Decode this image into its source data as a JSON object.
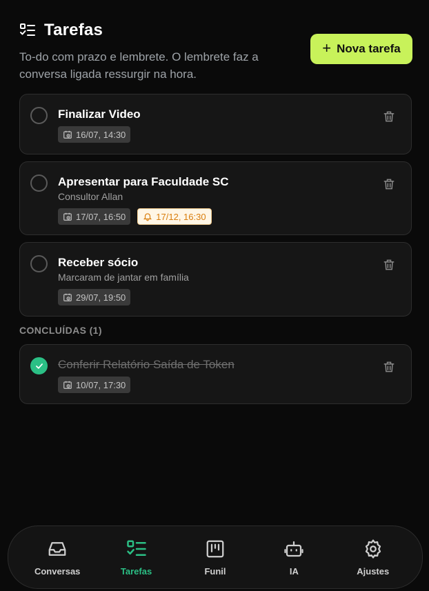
{
  "header": {
    "title": "Tarefas",
    "subtitle": "To-do com prazo e lembrete. O lembrete faz a conversa ligada ressurgir na hora.",
    "new_button_label": "Nova tarefa",
    "title_icon": "list-check-icon"
  },
  "tasks": [
    {
      "title": "Finalizar Video",
      "description": "",
      "due": "16/07, 14:30",
      "reminder": ""
    },
    {
      "title": "Apresentar para Faculdade SC",
      "description": "Consultor Allan",
      "due": "17/07, 16:50",
      "reminder": "17/12, 16:30"
    },
    {
      "title": "Receber sócio",
      "description": "Marcaram de jantar em família",
      "due": "29/07, 19:50",
      "reminder": ""
    }
  ],
  "completed": {
    "label": "CONCLUÍDAS (1)",
    "items": [
      {
        "title": "Conferir Relatório Saída de Token",
        "due": "10/07, 17:30"
      }
    ]
  },
  "nav": {
    "active": "Tarefas",
    "items": [
      {
        "label": "Conversas",
        "icon": "inbox-icon"
      },
      {
        "label": "Tarefas",
        "icon": "list-check-icon"
      },
      {
        "label": "Funil",
        "icon": "kanban-icon"
      },
      {
        "label": "IA",
        "icon": "bot-icon"
      },
      {
        "label": "Ajustes",
        "icon": "gear-icon"
      }
    ]
  },
  "colors": {
    "accent": "#c8f25a",
    "success": "#2bbf85",
    "reminder": "#d97d0c",
    "background": "#0a0a0a",
    "card": "#161616"
  }
}
